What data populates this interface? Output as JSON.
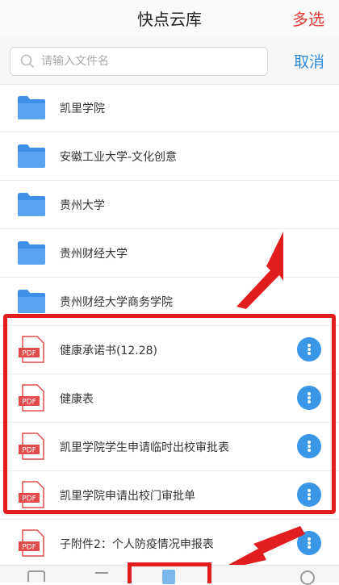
{
  "header": {
    "title": "快点云库",
    "multi_select": "多选"
  },
  "search": {
    "placeholder": "请输入文件名",
    "cancel": "取消"
  },
  "folders": [
    {
      "name": "凯里学院",
      "icon": "folder-icon"
    },
    {
      "name": "安徽工业大学-文化创意",
      "icon": "folder-icon"
    },
    {
      "name": "贵州大学",
      "icon": "folder-icon"
    },
    {
      "name": "贵州财经大学",
      "icon": "folder-icon"
    },
    {
      "name": "贵州财经大学商务学院",
      "icon": "folder-icon"
    }
  ],
  "files": [
    {
      "name": "健康承诺书(12.28)",
      "icon": "pdf-icon",
      "badge": "PDF"
    },
    {
      "name": "健康表",
      "icon": "pdf-icon",
      "badge": "PDF"
    },
    {
      "name": "凯里学院学生申请临时出校审批表",
      "icon": "pdf-icon",
      "badge": "PDF"
    },
    {
      "name": "凯里学院申请出校门审批单",
      "icon": "pdf-icon",
      "badge": "PDF"
    },
    {
      "name": "子附件2：个人防疫情况申报表",
      "icon": "pdf-icon",
      "badge": "PDF"
    }
  ],
  "colors": {
    "accent": "#2f8ad8",
    "danger": "#e53935",
    "folder": "#3f8fe8",
    "pdf": "#e04b4b"
  }
}
